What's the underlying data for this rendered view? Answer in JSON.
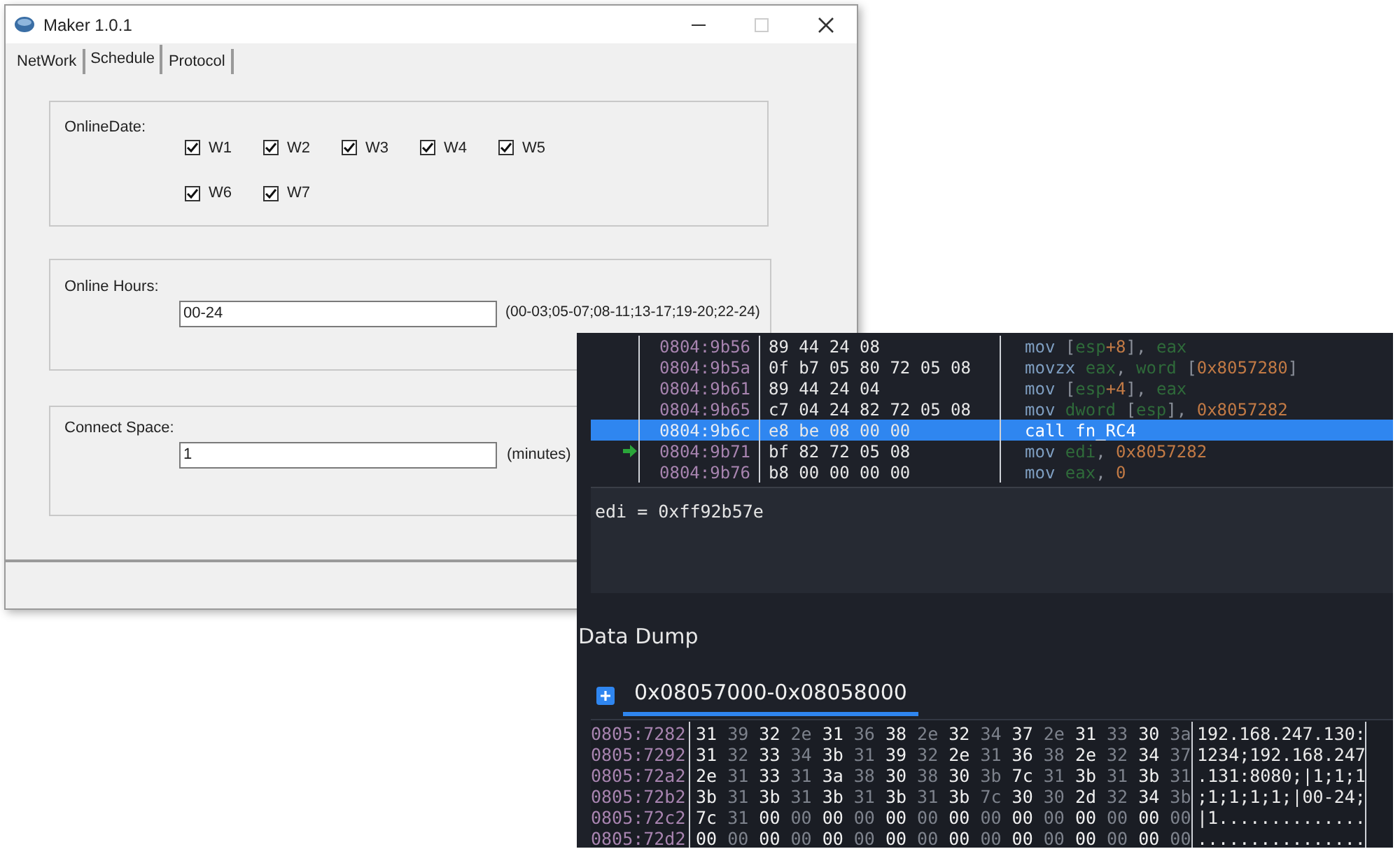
{
  "dialog": {
    "title": "Maker 1.0.1",
    "tabs": [
      {
        "label": "NetWork",
        "selected": false
      },
      {
        "label": "Schedule",
        "selected": true
      },
      {
        "label": "Protocol",
        "selected": false
      }
    ],
    "online_date": {
      "label": "OnlineDate:",
      "checkboxes": [
        {
          "label": "W1",
          "checked": true
        },
        {
          "label": "W2",
          "checked": true
        },
        {
          "label": "W3",
          "checked": true
        },
        {
          "label": "W4",
          "checked": true
        },
        {
          "label": "W5",
          "checked": true
        },
        {
          "label": "W6",
          "checked": true
        },
        {
          "label": "W7",
          "checked": true
        }
      ]
    },
    "online_hours": {
      "label": "Online Hours:",
      "value": "00-24",
      "hint": "(00-03;05-07;08-11;13-17;19-20;22-24)"
    },
    "connect_space": {
      "label": "Connect Space:",
      "value": "1",
      "unit": "(minutes)"
    }
  },
  "debugger": {
    "disassembly": [
      {
        "address": "0804:9b56",
        "bytes": "89 44 24 08",
        "selected": false,
        "current": false,
        "parts": [
          {
            "kind": "op",
            "text": "mov "
          },
          {
            "kind": "punct",
            "text": "["
          },
          {
            "kind": "reg",
            "text": "esp"
          },
          {
            "kind": "num",
            "text": "+8"
          },
          {
            "kind": "punct",
            "text": "], "
          },
          {
            "kind": "reg",
            "text": "eax"
          }
        ]
      },
      {
        "address": "0804:9b5a",
        "bytes": "0f b7 05 80 72 05 08",
        "selected": false,
        "current": false,
        "parts": [
          {
            "kind": "op",
            "text": "movzx "
          },
          {
            "kind": "reg",
            "text": "eax"
          },
          {
            "kind": "punct",
            "text": ", "
          },
          {
            "kind": "reg",
            "text": "word"
          },
          {
            "kind": "punct",
            "text": " ["
          },
          {
            "kind": "num",
            "text": "0x8057280"
          },
          {
            "kind": "punct",
            "text": "]"
          }
        ]
      },
      {
        "address": "0804:9b61",
        "bytes": "89 44 24 04",
        "selected": false,
        "current": false,
        "parts": [
          {
            "kind": "op",
            "text": "mov "
          },
          {
            "kind": "punct",
            "text": "["
          },
          {
            "kind": "reg",
            "text": "esp"
          },
          {
            "kind": "num",
            "text": "+4"
          },
          {
            "kind": "punct",
            "text": "], "
          },
          {
            "kind": "reg",
            "text": "eax"
          }
        ]
      },
      {
        "address": "0804:9b65",
        "bytes": "c7 04 24 82 72 05 08",
        "selected": false,
        "current": false,
        "parts": [
          {
            "kind": "op",
            "text": "mov "
          },
          {
            "kind": "reg",
            "text": "dword"
          },
          {
            "kind": "punct",
            "text": " ["
          },
          {
            "kind": "reg",
            "text": "esp"
          },
          {
            "kind": "punct",
            "text": "], "
          },
          {
            "kind": "num",
            "text": "0x8057282"
          }
        ]
      },
      {
        "address": "0804:9b6c",
        "bytes": "e8 be 08 00 00",
        "selected": true,
        "current": false,
        "parts": [
          {
            "kind": "op",
            "text": "call fn_RC4"
          }
        ]
      },
      {
        "address": "0804:9b71",
        "bytes": "bf 82 72 05 08",
        "selected": false,
        "current": true,
        "parts": [
          {
            "kind": "op",
            "text": "mov "
          },
          {
            "kind": "reg",
            "text": "edi"
          },
          {
            "kind": "punct",
            "text": ", "
          },
          {
            "kind": "num",
            "text": "0x8057282"
          }
        ]
      },
      {
        "address": "0804:9b76",
        "bytes": "b8 00 00 00 00",
        "selected": false,
        "current": false,
        "parts": [
          {
            "kind": "op",
            "text": "mov "
          },
          {
            "kind": "reg",
            "text": "eax"
          },
          {
            "kind": "punct",
            "text": ", "
          },
          {
            "kind": "num",
            "text": "0"
          }
        ]
      }
    ],
    "register_info": "edi = 0xff92b57e",
    "data_dump": {
      "title": "Data Dump",
      "range_tab": "0x08057000-0x08058000",
      "rows": [
        {
          "address": "0805:7282",
          "bytes": "31 39 32 2e 31 36 38 2e 32 34 37 2e 31 33 30 3a",
          "ascii": "192.168.247.130:"
        },
        {
          "address": "0805:7292",
          "bytes": "31 32 33 34 3b 31 39 32 2e 31 36 38 2e 32 34 37",
          "ascii": "1234;192.168.247"
        },
        {
          "address": "0805:72a2",
          "bytes": "2e 31 33 31 3a 38 30 38 30 3b 7c 31 3b 31 3b 31",
          "ascii": ".131:8080;|1;1;1"
        },
        {
          "address": "0805:72b2",
          "bytes": "3b 31 3b 31 3b 31 3b 31 3b 7c 30 30 2d 32 34 3b",
          "ascii": ";1;1;1;1;|00-24;"
        },
        {
          "address": "0805:72c2",
          "bytes": "7c 31 00 00 00 00 00 00 00 00 00 00 00 00 00 00",
          "ascii": "|1.............."
        },
        {
          "address": "0805:72d2",
          "bytes": "00 00 00 00 00 00 00 00 00 00 00 00 00 00 00 00",
          "ascii": "................"
        }
      ]
    }
  }
}
